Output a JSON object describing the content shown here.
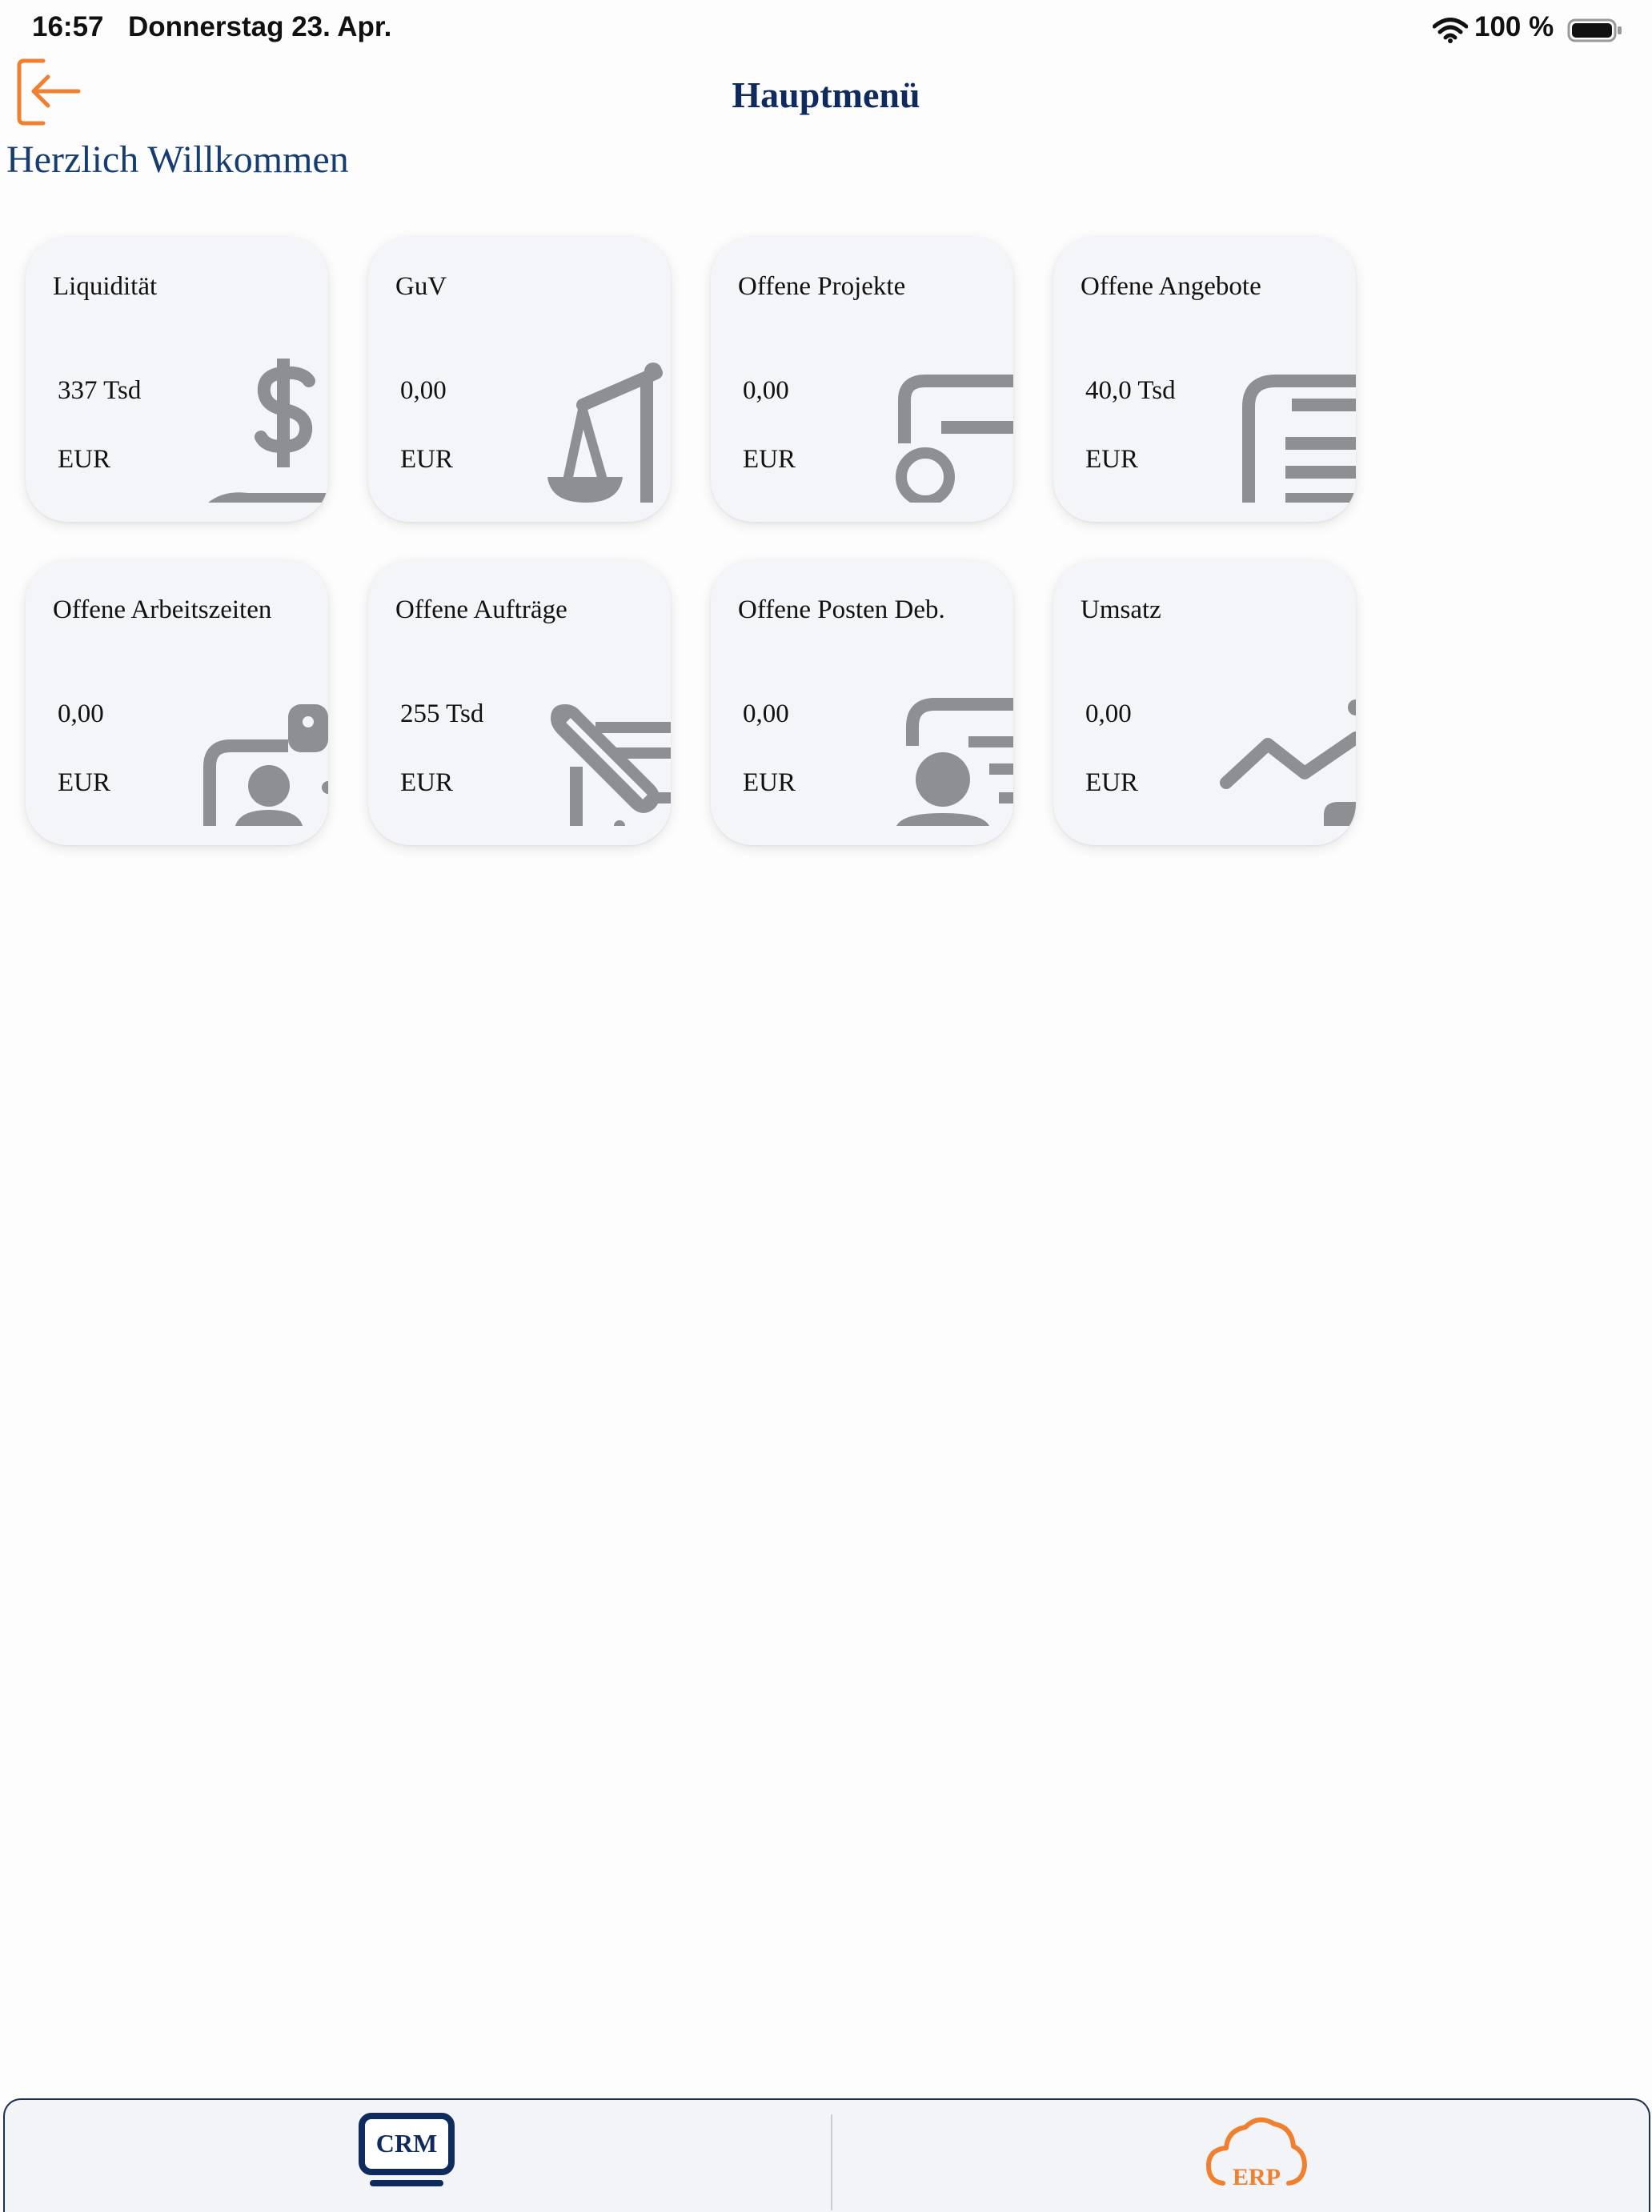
{
  "status_bar": {
    "time": "16:57",
    "date": "Donnerstag 23. Apr.",
    "battery": "100 %"
  },
  "header": {
    "title": "Hauptmenü",
    "welcome": "Herzlich Willkommen"
  },
  "colors": {
    "accent_orange": "#f07f2e",
    "title_navy": "#0f2a5c",
    "icon_grey": "#8e8f93",
    "tile_bg": "#f4f5f9"
  },
  "tiles": [
    {
      "title": "Liquidität",
      "value": "337 Tsd",
      "unit": "EUR",
      "icon": "money-hand-icon"
    },
    {
      "title": "GuV",
      "value": "0,00",
      "unit": "EUR",
      "icon": "balance-scale-icon"
    },
    {
      "title": "Offene Projekte",
      "value": "0,00",
      "unit": "EUR",
      "icon": "project-folder-icon"
    },
    {
      "title": "Offene Angebote",
      "value": "40,0 Tsd",
      "unit": "EUR",
      "icon": "document-list-icon"
    },
    {
      "title": "Offene Arbeitszeiten",
      "value": "0,00",
      "unit": "EUR",
      "icon": "employee-clock-icon"
    },
    {
      "title": "Offene Aufträge",
      "value": "255 Tsd",
      "unit": "EUR",
      "icon": "order-pencil-icon"
    },
    {
      "title": "Offene Posten Deb.",
      "value": "0,00",
      "unit": "EUR",
      "icon": "debtor-user-icon"
    },
    {
      "title": "Umsatz",
      "value": "0,00",
      "unit": "EUR",
      "icon": "revenue-chart-icon"
    }
  ],
  "bottom_nav": {
    "crm_label": "CRM",
    "erp_label": "ERP"
  }
}
